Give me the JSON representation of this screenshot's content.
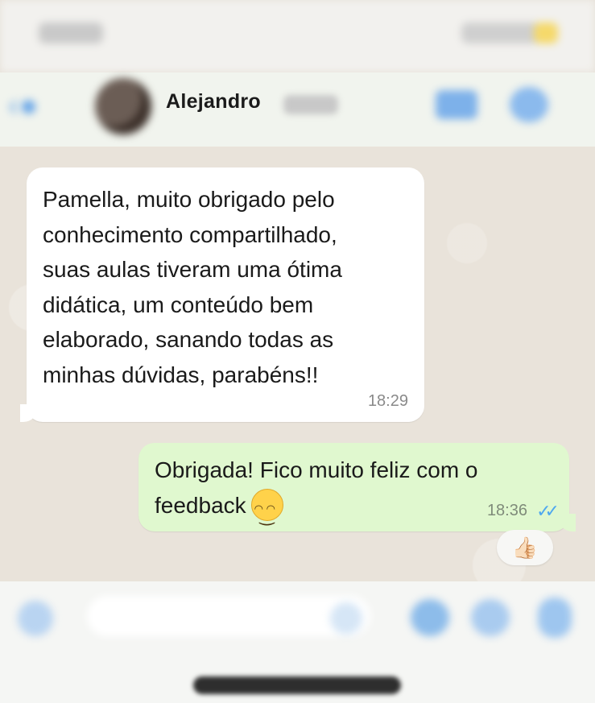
{
  "header": {
    "contact_name": "Alejandro"
  },
  "messages": [
    {
      "direction": "incoming",
      "text": "Pamella, muito obrigado pelo\nconhecimento compartilhado,\nsuas aulas tiveram uma ótima\ndidática, um conteúdo bem\nelaborado, sanando todas as\nminhas dúvidas, parabéns!!",
      "time": "18:29"
    },
    {
      "direction": "outgoing",
      "text": "Obrigada! Fico muito feliz com o\nfeedback",
      "emoji": "smiling-face-icon",
      "time": "18:36",
      "status": "read",
      "status_icon": "double-check-icon",
      "reaction": "👍🏻"
    }
  ],
  "colors": {
    "incoming_bubble": "#ffffff",
    "outgoing_bubble": "#e0f8cf",
    "chat_background": "#e9e3da",
    "read_ticks": "#4fa8ef"
  }
}
